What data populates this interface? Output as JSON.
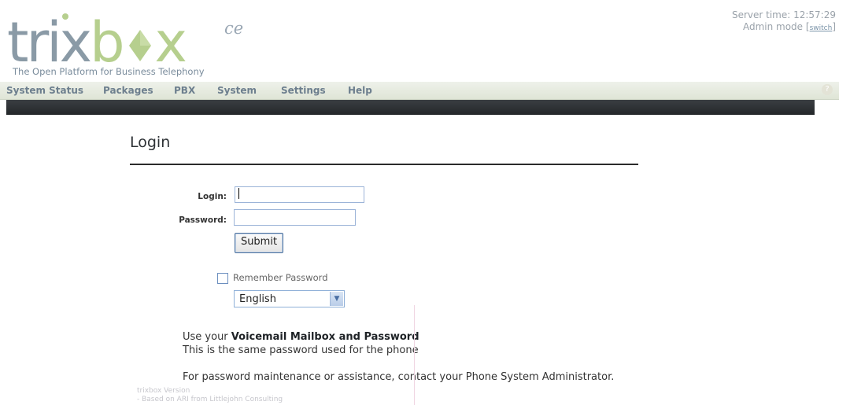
{
  "header": {
    "logo": {
      "part1": "trix",
      "part2": "b",
      "part3": "x",
      "suffix": "ce"
    },
    "tagline": "The Open Platform for Business Telephony",
    "server_time": "Server time: 12:57:29",
    "admin_mode": "Admin mode",
    "switch_label": "switch"
  },
  "nav": {
    "items": [
      "System Status",
      "Packages",
      "PBX",
      "System",
      "Settings",
      "Help"
    ]
  },
  "login": {
    "title": "Login",
    "login_label": "Login:",
    "login_value": "",
    "password_label": "Password:",
    "password_value": "",
    "submit_label": "Submit",
    "remember_label": "Remember Password",
    "remember_checked": false,
    "language_selected": "English"
  },
  "info": {
    "line1_prefix": "Use your ",
    "line1_bold": "Voicemail Mailbox and Password",
    "line2": "This is the same password used for the phone",
    "line3": "For password maintenance or assistance, contact your Phone System Administrator."
  },
  "footer": {
    "line1": "trixbox Version",
    "line2": "- Based on ARI from Littlejohn Consulting"
  },
  "colors": {
    "logo_gray": "#8a9aa6",
    "logo_green": "#b6cf8e",
    "nav_text": "#6d7f8e",
    "dark_bar": "#2a2d30"
  }
}
